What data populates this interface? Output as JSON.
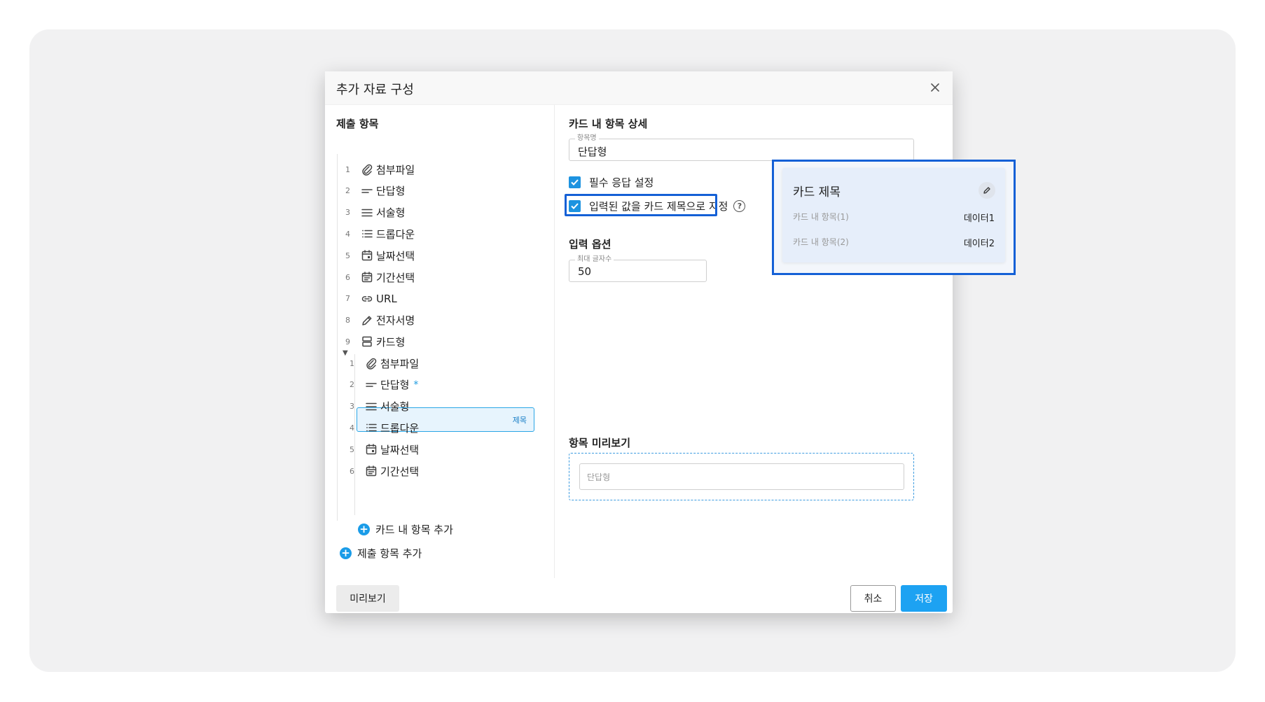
{
  "dialog": {
    "title": "추가 자료 구성"
  },
  "left": {
    "section_title": "제출 항목",
    "items": [
      {
        "num": "1",
        "label": "첨부파일",
        "icon": "paperclip-icon"
      },
      {
        "num": "2",
        "label": "단답형",
        "icon": "short-text-icon"
      },
      {
        "num": "3",
        "label": "서술형",
        "icon": "long-text-icon"
      },
      {
        "num": "4",
        "label": "드롭다운",
        "icon": "list-icon"
      },
      {
        "num": "5",
        "label": "날짜선택",
        "icon": "calendar-icon"
      },
      {
        "num": "6",
        "label": "기간선택",
        "icon": "calendar-range-icon"
      },
      {
        "num": "7",
        "label": "URL",
        "icon": "link-icon"
      },
      {
        "num": "8",
        "label": "전자서명",
        "icon": "pen-icon"
      },
      {
        "num": "9",
        "label": "카드형",
        "icon": "card-icon"
      }
    ],
    "sub_items": [
      {
        "num": "1",
        "label": "첨부파일",
        "icon": "paperclip-icon"
      },
      {
        "num": "2",
        "label": "단답형",
        "icon": "short-text-icon",
        "required_mark": "*",
        "badge": "제목"
      },
      {
        "num": "3",
        "label": "서술형",
        "icon": "long-text-icon"
      },
      {
        "num": "4",
        "label": "드롭다운",
        "icon": "list-icon"
      },
      {
        "num": "5",
        "label": "날짜선택",
        "icon": "calendar-icon"
      },
      {
        "num": "6",
        "label": "기간선택",
        "icon": "calendar-range-icon"
      }
    ],
    "add_card_item": "카드 내 항목 추가",
    "add_submit_item": "제출 항목 추가"
  },
  "right": {
    "detail_title": "카드 내 항목 상세",
    "name_field": {
      "label": "항목명",
      "value": "단답형"
    },
    "required_checkbox": {
      "label": "필수 응답 설정",
      "checked": true
    },
    "title_checkbox": {
      "label": "입력된 값을 카드 제목으로 지정",
      "checked": true
    },
    "input_options_title": "입력 옵션",
    "max_chars": {
      "label": "최대 글자수",
      "value": "50"
    },
    "preview_title": "항목 미리보기",
    "preview_placeholder": "단답형"
  },
  "footer": {
    "preview": "미리보기",
    "cancel": "취소",
    "save": "저장"
  },
  "callout": {
    "title": "카드 제목",
    "rows": [
      {
        "key": "카드 내 항목(1)",
        "value": "데이터1"
      },
      {
        "key": "카드 내 항목(2)",
        "value": "데이터2"
      }
    ]
  },
  "colors": {
    "accent": "#1da2f2",
    "highlight": "#1460d6",
    "checkbox": "#1d93e0"
  }
}
